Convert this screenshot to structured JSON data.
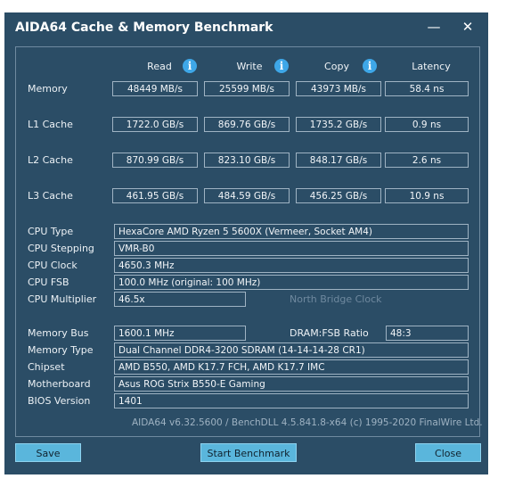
{
  "window": {
    "title": "AIDA64 Cache & Memory Benchmark",
    "minimize_glyph": "—",
    "close_glyph": "✕"
  },
  "columns": {
    "read": "Read",
    "write": "Write",
    "copy": "Copy",
    "latency": "Latency"
  },
  "info_glyph": "i",
  "rows": [
    {
      "label": "Memory",
      "read": "48449 MB/s",
      "write": "25599 MB/s",
      "copy": "43973 MB/s",
      "latency": "58.4 ns"
    },
    {
      "label": "L1 Cache",
      "read": "1722.0 GB/s",
      "write": "869.76 GB/s",
      "copy": "1735.2 GB/s",
      "latency": "0.9 ns"
    },
    {
      "label": "L2 Cache",
      "read": "870.99 GB/s",
      "write": "823.10 GB/s",
      "copy": "848.17 GB/s",
      "latency": "2.6 ns"
    },
    {
      "label": "L3 Cache",
      "read": "461.95 GB/s",
      "write": "484.59 GB/s",
      "copy": "456.25 GB/s",
      "latency": "10.9 ns"
    }
  ],
  "cpu": {
    "type_label": "CPU Type",
    "type_value": "HexaCore AMD Ryzen 5 5600X  (Vermeer, Socket AM4)",
    "stepping_label": "CPU Stepping",
    "stepping_value": "VMR-B0",
    "clock_label": "CPU Clock",
    "clock_value": "4650.3 MHz",
    "fsb_label": "CPU FSB",
    "fsb_value": "100.0 MHz  (original: 100 MHz)",
    "multiplier_label": "CPU Multiplier",
    "multiplier_value": "46.5x",
    "nb_clock_label": "North Bridge Clock"
  },
  "mem": {
    "bus_label": "Memory Bus",
    "bus_value": "1600.1 MHz",
    "ratio_label": "DRAM:FSB Ratio",
    "ratio_value": "48:3",
    "type_label": "Memory Type",
    "type_value": "Dual Channel DDR4-3200 SDRAM  (14-14-14-28 CR1)",
    "chipset_label": "Chipset",
    "chipset_value": "AMD B550, AMD K17.7 FCH, AMD K17.7 IMC",
    "mobo_label": "Motherboard",
    "mobo_value": "Asus ROG Strix B550-E Gaming",
    "bios_label": "BIOS Version",
    "bios_value": "1401"
  },
  "footer": "AIDA64 v6.32.5600 / BenchDLL 4.5.841.8-x64  (c) 1995-2020 FinalWire Ltd.",
  "buttons": {
    "save_label": "Save",
    "start_label": "Start Benchmark",
    "close_label": "Close"
  },
  "colors": {
    "background": "#2b4d66",
    "accent": "#5ab6dc",
    "info": "#3ea7e8"
  }
}
